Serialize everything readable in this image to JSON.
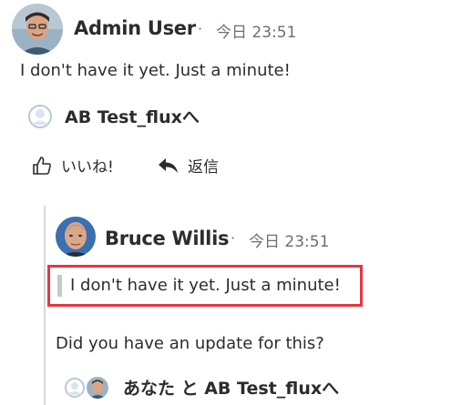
{
  "comment": {
    "author": "Admin User",
    "separator": "·",
    "timestamp": "今日 23:51",
    "text": "I don't have it yet. Just a minute!",
    "mention": "AB Test_fluxへ",
    "actions": {
      "like": "いいね!",
      "reply": "返信"
    }
  },
  "reply": {
    "author": "Bruce Willis",
    "separator": "·",
    "timestamp": "今日 23:51",
    "quote": "I don't have it yet. Just a minute!",
    "text": "Did you have an update for this?",
    "mention": "あなた と AB Test_fluxへ"
  },
  "colors": {
    "highlight_border": "#e5363f",
    "thread_line": "#d6d6d6",
    "quote_bar": "#c8c8c8",
    "avatar_placeholder": "#b9c9d6"
  }
}
